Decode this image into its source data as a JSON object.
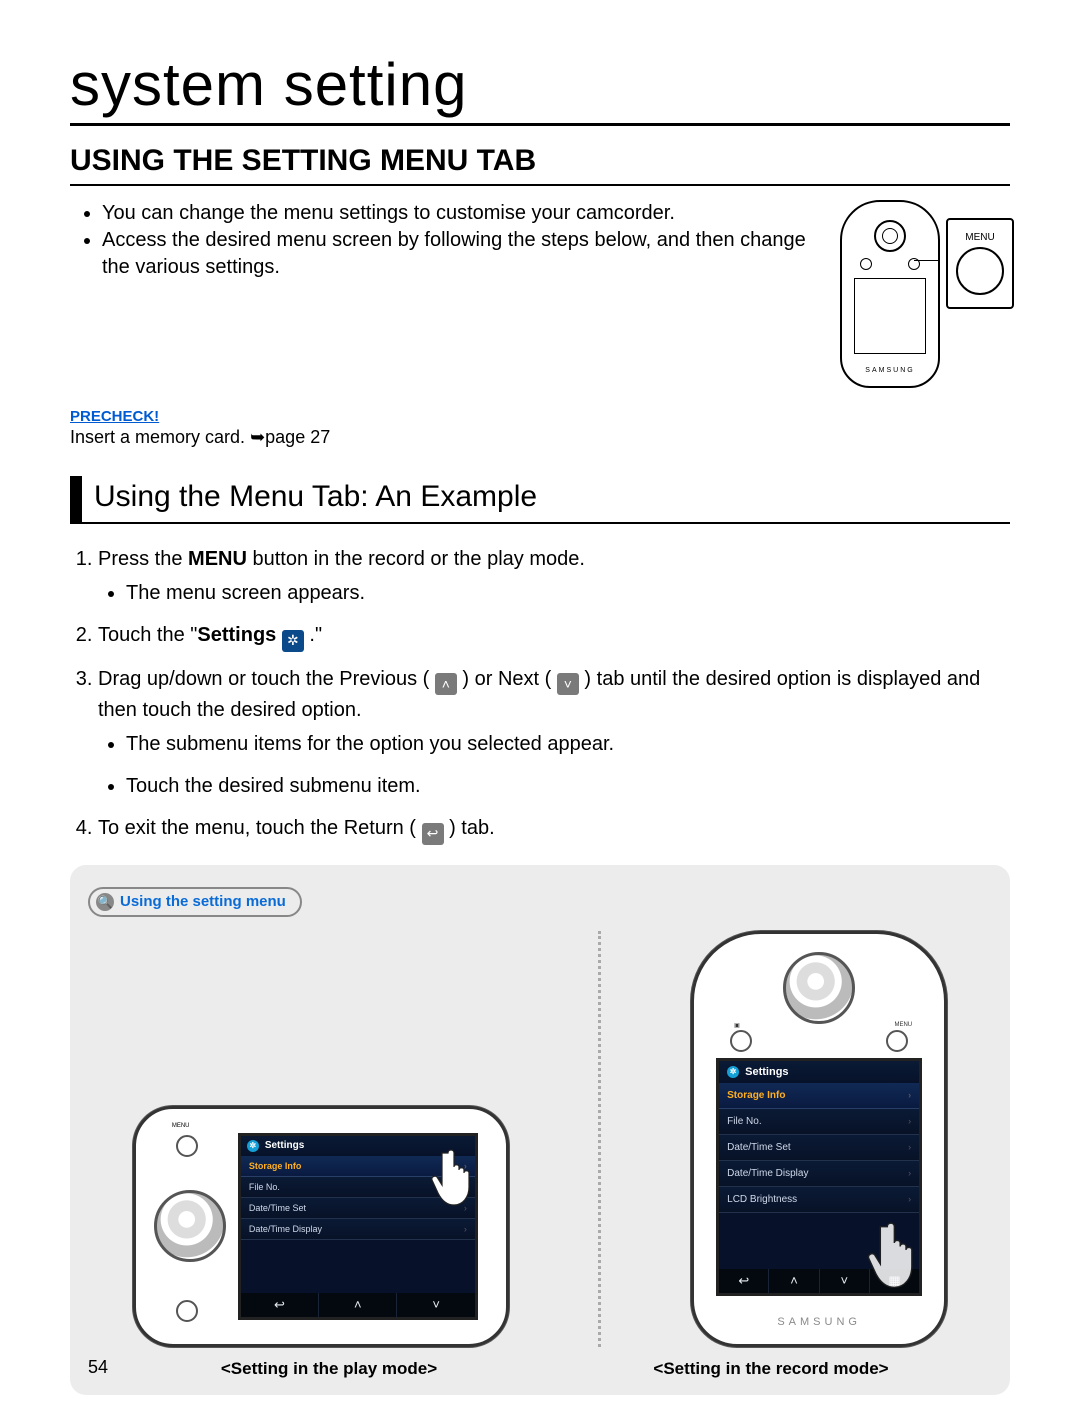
{
  "page": {
    "number": "54",
    "title": "system setting"
  },
  "section_heading": "USING THE SETTING MENU TAB",
  "intro_bullets": [
    "You can change the menu settings to customise your camcorder.",
    "Access the desired menu screen by following the steps below, and then change the various settings."
  ],
  "callout": {
    "label": "MENU"
  },
  "precheck": {
    "label": "PRECHECK!",
    "text_prefix": "Insert a memory card. ",
    "text_suffix": "page 27"
  },
  "sub_heading": "Using the Menu Tab: An Example",
  "steps": {
    "s1_prefix": "Press the ",
    "s1_bold": "MENU",
    "s1_suffix": " button in the record or the play mode.",
    "s1_sub": "The menu screen appears.",
    "s2_prefix": "Touch the \"",
    "s2_bold": "Settings",
    "s2_suffix": " .\"",
    "s3_a": "Drag up/down or touch the Previous ( ",
    "s3_b": " ) or Next ( ",
    "s3_c": " ) tab until the desired option is displayed and then touch the desired option.",
    "s3_sub1": "The submenu items for the option you selected appear.",
    "s3_sub2": "Touch the desired submenu item.",
    "s4_a": "To exit the menu, touch the Return ( ",
    "s4_b": " ) tab."
  },
  "panel": {
    "pill_label": "Using the setting menu",
    "caption_play": "<Setting in the play mode>",
    "caption_record": "<Setting in the record mode>"
  },
  "screen": {
    "settings_label": "Settings",
    "rows_play": [
      "Storage Info",
      "File No.",
      "Date/Time Set",
      "Date/Time Display"
    ],
    "rows_record": [
      "Storage Info",
      "File No.",
      "Date/Time Set",
      "Date/Time Display",
      "LCD Brightness"
    ],
    "footer_icons": [
      "↩",
      "˄",
      "˅"
    ],
    "brand": "SAMSUNG",
    "menu_btn": "MENU"
  }
}
